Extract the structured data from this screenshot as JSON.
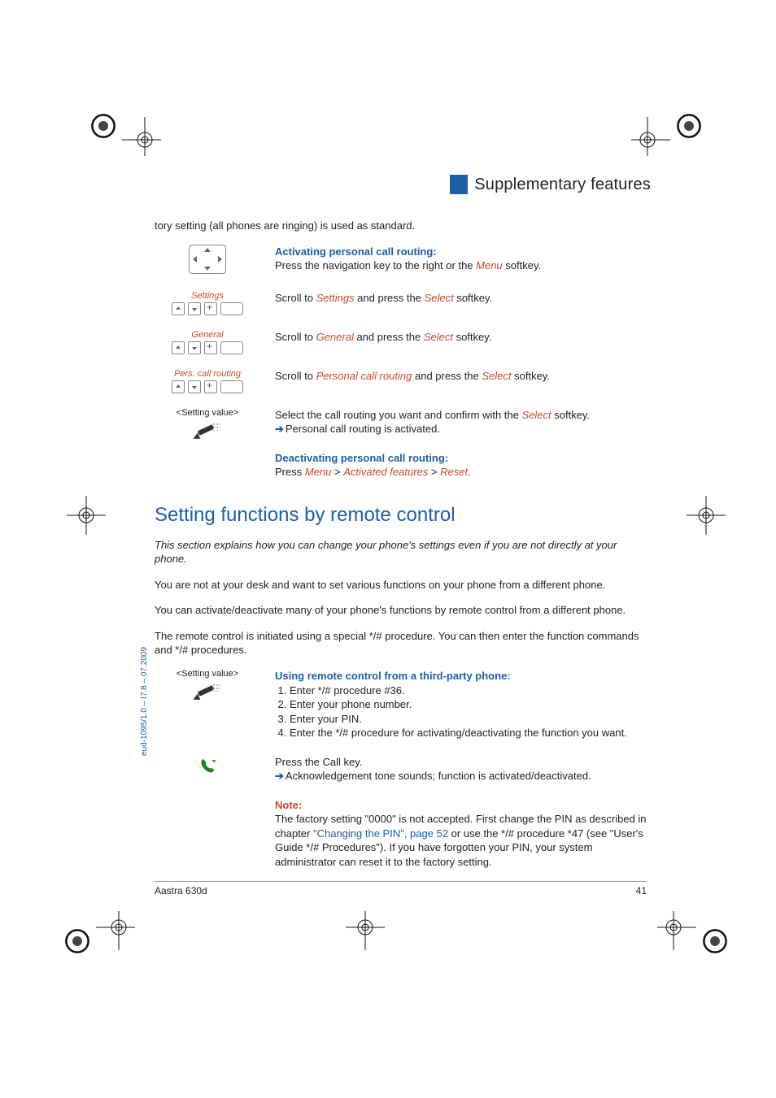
{
  "header": {
    "section_title": "Supplementary features"
  },
  "intro_continuation": "tory setting (all phones are ringing) is used as standard.",
  "activating": {
    "heading": "Activating personal call routing:",
    "steps": [
      {
        "left_label": "",
        "icon": "navkey",
        "text_pre": "Press the navigation key to the right or the ",
        "text_em": "Menu",
        "text_post": " softkey."
      },
      {
        "left_label": "Settings",
        "icon": "scroll",
        "text_pre": "Scroll to ",
        "text_em": "Settings",
        "text_mid": " and press the ",
        "text_em2": "Select",
        "text_post": " softkey."
      },
      {
        "left_label": "General",
        "icon": "scroll",
        "text_pre": "Scroll to ",
        "text_em": "General",
        "text_mid": " and press the ",
        "text_em2": "Select",
        "text_post": " softkey."
      },
      {
        "left_label": "Pers. call routing",
        "icon": "scroll",
        "text_pre": "Scroll to ",
        "text_em": "Personal call routing",
        "text_mid": " and press the ",
        "text_em2": "Select",
        "text_post": " softkey."
      },
      {
        "left_label": "<Setting value>",
        "icon": "pencil",
        "text_pre": "Select the call routing you want and confirm with the ",
        "text_em": "Select",
        "text_post": " softkey.",
        "result": "Personal call routing is activated."
      }
    ]
  },
  "deactivating": {
    "heading": "Deactivating personal call routing:",
    "press": "Press ",
    "menu": "Menu",
    "gt1": " > ",
    "activated": "Activated features",
    "gt2": " > ",
    "reset": "Reset",
    "dot": "."
  },
  "section2": {
    "title": "Setting functions by remote control",
    "intro_italic": "This section explains how you can change your phone's settings even if you are not directly at your phone.",
    "p1": "You are not at your desk and want to set various functions on your phone from a different phone.",
    "p2": "You can activate/deactivate many of your phone's functions by remote control from a different phone.",
    "p3": "The remote control is initiated using a special */# procedure. You can then enter the function commands and */# procedures."
  },
  "remote_steps": {
    "left_label": "<Setting value>",
    "heading": "Using remote control from a third-party phone:",
    "steps": [
      "Enter */# procedure #36.",
      "Enter your phone number.",
      "Enter your PIN.",
      "Enter the */# procedure for activating/deactivating the function you want."
    ],
    "call": {
      "line": "Press the Call key.",
      "result": "Acknowledgement tone sounds; function is activated/deactivated."
    }
  },
  "note": {
    "label": "Note:",
    "t1": "The factory setting \"0000\" is not accepted. First change the PIN as described in chapter ",
    "link": "\"Changing the PIN\", page 52",
    "t2": " or use the */# procedure *47 (see \"User's Guide */# Procedures\"). If you have forgotten your PIN, your system administrator can reset it to the factory setting."
  },
  "footer": {
    "product": "Aastra 630d",
    "page": "41"
  },
  "doc_id": "eud-1095/1.0 – I7.8 – 07.2009"
}
